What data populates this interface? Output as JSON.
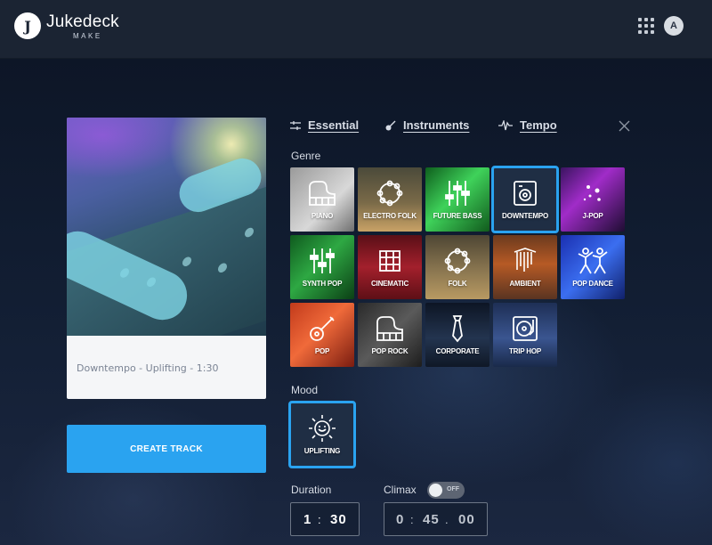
{
  "header": {
    "logo_glyph": "J",
    "brand": "Jukedeck",
    "sub": "MAKE",
    "avatar_initial": "A"
  },
  "preview": {
    "caption": "Downtempo - Uplifting - 1:30"
  },
  "create_button": "CREATE TRACK",
  "tabs": [
    {
      "label": "Essential",
      "icon": "sliders-icon"
    },
    {
      "label": "Instruments",
      "icon": "guitar-icon"
    },
    {
      "label": "Tempo",
      "icon": "waveform-icon"
    }
  ],
  "genre": {
    "label": "Genre",
    "selected": "DOWNTEMPO",
    "items": [
      {
        "name": "PIANO",
        "icon": "piano-icon"
      },
      {
        "name": "ELECTRO FOLK",
        "icon": "tambourine-icon"
      },
      {
        "name": "FUTURE BASS",
        "icon": "faders-icon"
      },
      {
        "name": "DOWNTEMPO",
        "icon": "speaker-icon"
      },
      {
        "name": "J-POP",
        "icon": "sparkle-icon"
      },
      {
        "name": "SYNTH POP",
        "icon": "faders-icon"
      },
      {
        "name": "CINEMATIC",
        "icon": "knot-icon"
      },
      {
        "name": "FOLK",
        "icon": "tambourine-icon"
      },
      {
        "name": "AMBIENT",
        "icon": "chimes-icon"
      },
      {
        "name": "POP DANCE",
        "icon": "dancers-icon"
      },
      {
        "name": "POP",
        "icon": "guitar-icon"
      },
      {
        "name": "POP ROCK",
        "icon": "piano-icon"
      },
      {
        "name": "CORPORATE",
        "icon": "tie-icon"
      },
      {
        "name": "TRIP HOP",
        "icon": "turntable-icon"
      }
    ]
  },
  "mood": {
    "label": "Mood",
    "items": [
      {
        "name": "UPLIFTING",
        "icon": "sun-smile-icon"
      }
    ]
  },
  "duration": {
    "label": "Duration",
    "minutes": "1",
    "sep": ":",
    "seconds": "30"
  },
  "climax": {
    "label": "Climax",
    "toggle_text": "OFF",
    "minutes": "0",
    "seconds": "45",
    "fraction": "00"
  },
  "colors": {
    "accent": "#2aa3f0",
    "header_bg": "#1b2433"
  }
}
